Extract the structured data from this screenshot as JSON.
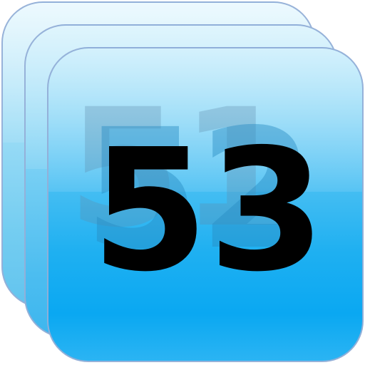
{
  "icon": {
    "numbers": {
      "back": "51",
      "middle": "52",
      "front": "53"
    },
    "colors": {
      "card_light": "#d6f2fc",
      "card_accent": "#0aa8f2",
      "card_border": "#96afd7",
      "front_number": "#000000"
    }
  }
}
